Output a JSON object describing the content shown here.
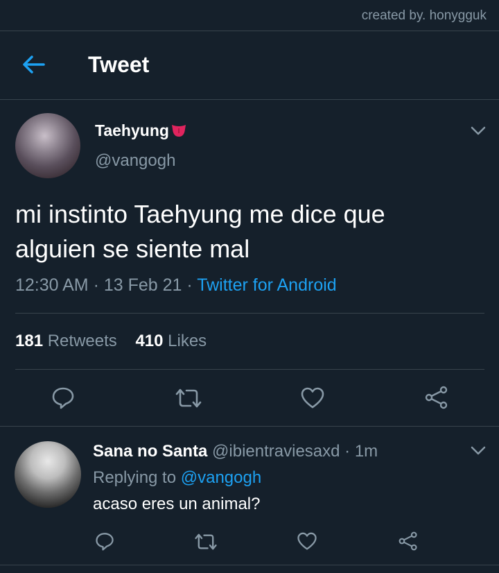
{
  "credit": "created by. honygguk",
  "header": {
    "title": "Tweet",
    "back_icon": "arrow-left-icon"
  },
  "tweet": {
    "author_name": "Taehyung",
    "author_emoji": "tongue-emoji",
    "author_handle": "@vangogh",
    "text_line1": "mi instinto Taehyung me dice que",
    "text_line2": "alguien se siente mal",
    "time": "12:30 AM · 13 Feb 21 · ",
    "source": "Twitter for Android",
    "retweet_count": "181",
    "retweet_label": "Retweets",
    "like_count": "410",
    "like_label": "Likes"
  },
  "reply": {
    "author_name": "Sana no Santa",
    "author_handle_time": " @ibientraviesaxd · 1m",
    "replying_label": "Replying to ",
    "replying_mention": "@vangogh",
    "text": "acaso eres un animal?"
  },
  "colors": {
    "background": "#15202b",
    "accent": "#1da1f2",
    "secondary_text": "#8899a6",
    "divider": "#38444d",
    "emoji": "#e0245e"
  }
}
